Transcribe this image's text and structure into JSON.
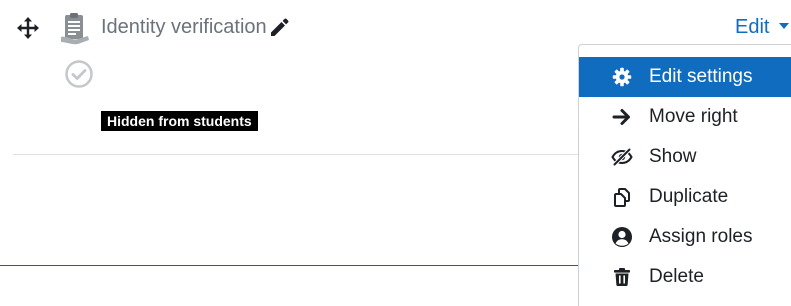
{
  "activity": {
    "title": "Identity verification",
    "hidden_badge": "Hidden from students",
    "icon": "assignment-clipboard-icon",
    "completion_icon": "check-circle-icon"
  },
  "edit_menu": {
    "toggle_label": "Edit",
    "items": [
      {
        "label": "Edit settings",
        "icon": "gear-icon",
        "active": true
      },
      {
        "label": "Move right",
        "icon": "arrow-right-icon",
        "active": false
      },
      {
        "label": "Show",
        "icon": "eye-slash-icon",
        "active": false
      },
      {
        "label": "Duplicate",
        "icon": "copy-icon",
        "active": false
      },
      {
        "label": "Assign roles",
        "icon": "user-circle-icon",
        "active": false
      },
      {
        "label": "Delete",
        "icon": "trash-icon",
        "active": false
      }
    ]
  },
  "colors": {
    "link": "#0f6cbf",
    "active_bg": "#0f6cbf",
    "muted_text": "#6a737b",
    "badge_bg": "#000000"
  }
}
